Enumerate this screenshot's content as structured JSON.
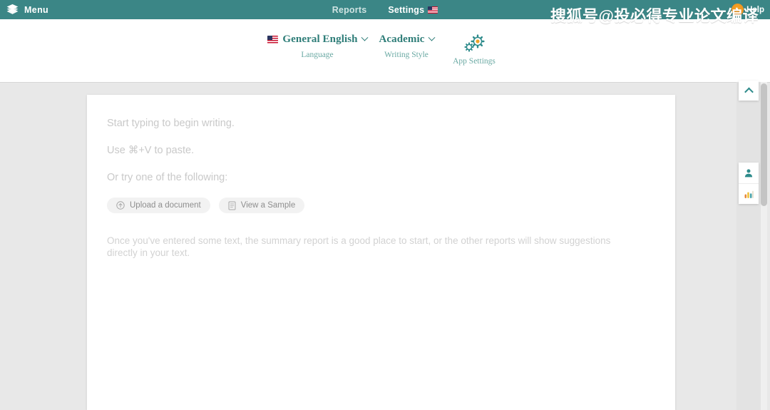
{
  "topbar": {
    "brand_label": "Menu",
    "brand_icon": "layers-logo-icon",
    "nav": [
      {
        "label": "Reports",
        "active": false,
        "flag": false
      },
      {
        "label": "Settings",
        "active": true,
        "flag": true
      }
    ],
    "help_label": "Help",
    "help_icon": "help-badge-icon",
    "bar_color": "#3b8686",
    "active_underline_color": "#e8a33d"
  },
  "watermark": {
    "text": "搜狐号@投必得专业论文编译"
  },
  "subnav": {
    "language": {
      "title": "General English",
      "caption": "Language",
      "flag_icon": "us-flag-icon",
      "chevron_icon": "chevron-down-icon"
    },
    "writing_style": {
      "title": "Academic",
      "caption": "Writing Style",
      "chevron_icon": "chevron-down-icon"
    },
    "app_settings": {
      "caption": "App Settings",
      "icon": "gears-icon"
    },
    "accent_color": "#2e7d78",
    "caption_color": "#6aa9a3"
  },
  "editor": {
    "lines": [
      "Start typing to begin writing.",
      "Use ⌘+V to paste.",
      "Or try one of the following:"
    ],
    "buttons": [
      {
        "label": "Upload a document",
        "icon": "upload-circle-icon"
      },
      {
        "label": "View a Sample",
        "icon": "document-icon"
      }
    ],
    "footnote": "Once you've entered some text, the summary report is a good place to start, or the other reports will show suggestions directly in your text."
  },
  "right_rail": {
    "collapse_icon": "chevron-up-icon",
    "buttons": [
      {
        "icon": "user-icon",
        "name": "account-button"
      },
      {
        "icon": "bar-chart-icon",
        "name": "statistics-button"
      }
    ]
  }
}
